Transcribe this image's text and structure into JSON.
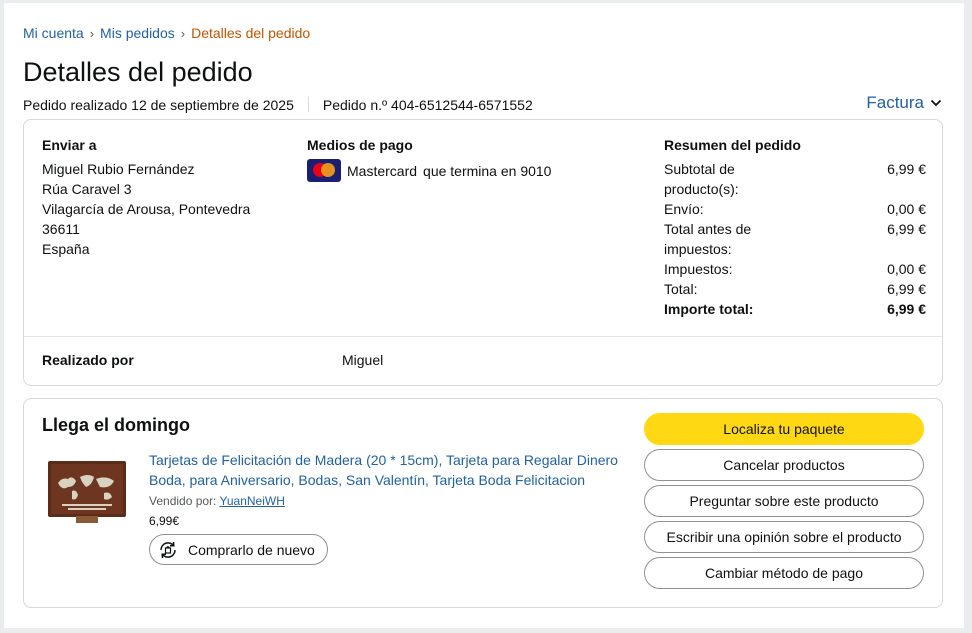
{
  "breadcrumb": {
    "items": [
      "Mi cuenta",
      "Mis pedidos"
    ],
    "current": "Detalles del pedido",
    "separator": "›"
  },
  "page_title": "Detalles del pedido",
  "order_meta": {
    "placed": "Pedido realizado 12 de septiembre de 2025",
    "number": "Pedido n.º 404-6512544-6571552"
  },
  "invoice_label": "Factura",
  "shipping": {
    "heading": "Enviar a",
    "lines": [
      "Miguel Rubio Fernández",
      "Rúa Caravel 3",
      "Vilagarcía de Arousa, Pontevedra",
      "36611",
      "España"
    ]
  },
  "payment": {
    "heading": "Medios de pago",
    "card_brand": "Mastercard",
    "card_text": "que termina en 9010",
    "icon": "mastercard-icon"
  },
  "summary": {
    "heading": "Resumen del pedido",
    "rows": [
      {
        "label": "Subtotal de producto(s):",
        "value": "6,99 €"
      },
      {
        "label": "Envío:",
        "value": "0,00 €"
      },
      {
        "label": "Total antes de impuestos:",
        "value": "6,99 €"
      },
      {
        "label": "Impuestos:",
        "value": "0,00 €"
      },
      {
        "label": "Total:",
        "value": "6,99 €"
      }
    ],
    "grand_total_label": "Importe total:",
    "grand_total_value": "6,99 €"
  },
  "placed_by": {
    "label": "Realizado por",
    "value": "Miguel"
  },
  "delivery": {
    "title": "Llega el domingo",
    "product_title": "Tarjetas de Felicitación de Madera (20 * 15cm), Tarjeta para Regalar Dinero Boda, para Aniversario, Bodas, San Valentín, Tarjeta Boda Felicitacion",
    "sold_by_label": "Vendido por:",
    "seller": "YuanNeiWH",
    "price": "6,99€",
    "rebuy_label": "Comprarlo de nuevo"
  },
  "actions": {
    "track": "Localiza tu paquete",
    "cancel": "Cancelar productos",
    "ask": "Preguntar sobre este producto",
    "review": "Escribir una opinión sobre el producto",
    "change_payment": "Cambiar método de pago"
  },
  "colors": {
    "link": "#2162a1",
    "breadcrumb_current": "#c45500",
    "primary_button": "#ffd814",
    "border": "#d5d9d9"
  }
}
